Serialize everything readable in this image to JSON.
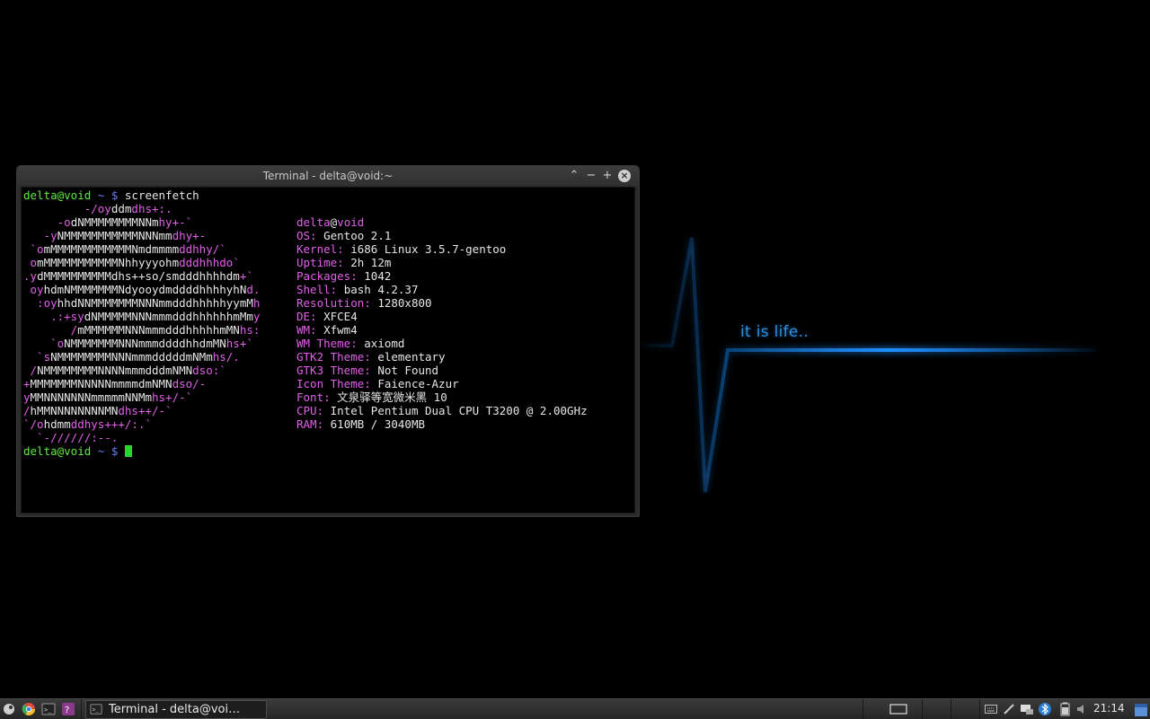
{
  "wallpaper": {
    "tagline": "it is life..",
    "accent": "#1e8fff"
  },
  "window": {
    "title": "Terminal - delta@void:~",
    "controls": [
      "chevron-up-icon",
      "minimize-icon",
      "maximize-icon",
      "close-icon"
    ],
    "control_glyphs": {
      "up": "⌃",
      "min": "−",
      "max": "+",
      "close": "×"
    }
  },
  "terminal": {
    "prompt_user": "delta@void",
    "prompt_path": "~",
    "prompt_sym": "$",
    "command": "screenfetch",
    "logo": [
      "         -/oyddmdhs+:.",
      "     -odNMMMMMMMMNNmhy+-`",
      "   -yNMMMMMMMMMMMNNNmmdhy+-",
      " `omMMMMMMMMMMMMNmdmmmmddhhy/`",
      " omMMMMMMMMMMMNhhyyyohmdddhhhdo`",
      ".ydMMMMMMMMMMdhs++so/smdddhhhhdm+`",
      " oyhdmNMMMMMMMNdyooydmddddhhhhyhNd.",
      "  :oyhhdNNMMMMMMMNNNmmdddhhhhhyymMh",
      "    .:+sydNMMMMMNNNmmmdddhhhhhhmMmy",
      "       /mMMMMMMNNNmmmdddhhhhhmMNhs:",
      "    `oNMMMMMMMNNNmmmddddhhdmMNhs+`",
      "  `sNMMMMMMMMNNNmmmdddddmNMmhs/.",
      " /NMMMMMMMMNNNNmmmdddmNMNdso:`",
      "+MMMMMMMNNNNNmmmmdmNMNdso/-",
      "yMMNNNNNNNmmmmmNNMmhs+/-`",
      "/hMMNNNNNNNNMNdhs++/-`",
      "`/ohdmmddhys+++/:.`",
      "  `-//////:--."
    ],
    "info": [
      {
        "key": "",
        "value": "delta@void"
      },
      {
        "key": "OS:",
        "value": "Gentoo 2.1"
      },
      {
        "key": "Kernel:",
        "value": "i686 Linux 3.5.7-gentoo"
      },
      {
        "key": "Uptime:",
        "value": "2h 12m"
      },
      {
        "key": "Packages:",
        "value": "1042"
      },
      {
        "key": "Shell:",
        "value": "bash 4.2.37"
      },
      {
        "key": "Resolution:",
        "value": "1280x800"
      },
      {
        "key": "DE:",
        "value": "XFCE4"
      },
      {
        "key": "WM:",
        "value": "Xfwm4"
      },
      {
        "key": "WM Theme:",
        "value": "axiomd"
      },
      {
        "key": "GTK2 Theme:",
        "value": "elementary"
      },
      {
        "key": "GTK3 Theme:",
        "value": "Not Found"
      },
      {
        "key": "Icon Theme:",
        "value": "Faience-Azur"
      },
      {
        "key": "Font:",
        "value": "文泉驿等宽微米黑 10"
      },
      {
        "key": "CPU:",
        "value": "Intel Pentium Dual CPU T3200 @ 2.00GHz"
      },
      {
        "key": "RAM:",
        "value": "610MB / 3040MB"
      }
    ]
  },
  "taskbar": {
    "launchers": [
      "app-menu-icon",
      "chromium-icon",
      "terminal-icon",
      "app-icon"
    ],
    "task_label": "Terminal - delta@voi…",
    "tray_icons": [
      "keyboard-icon",
      "pen-icon",
      "network-icon",
      "bluetooth-icon",
      "battery-icon",
      "volume-icon"
    ],
    "clock": "21:14"
  }
}
